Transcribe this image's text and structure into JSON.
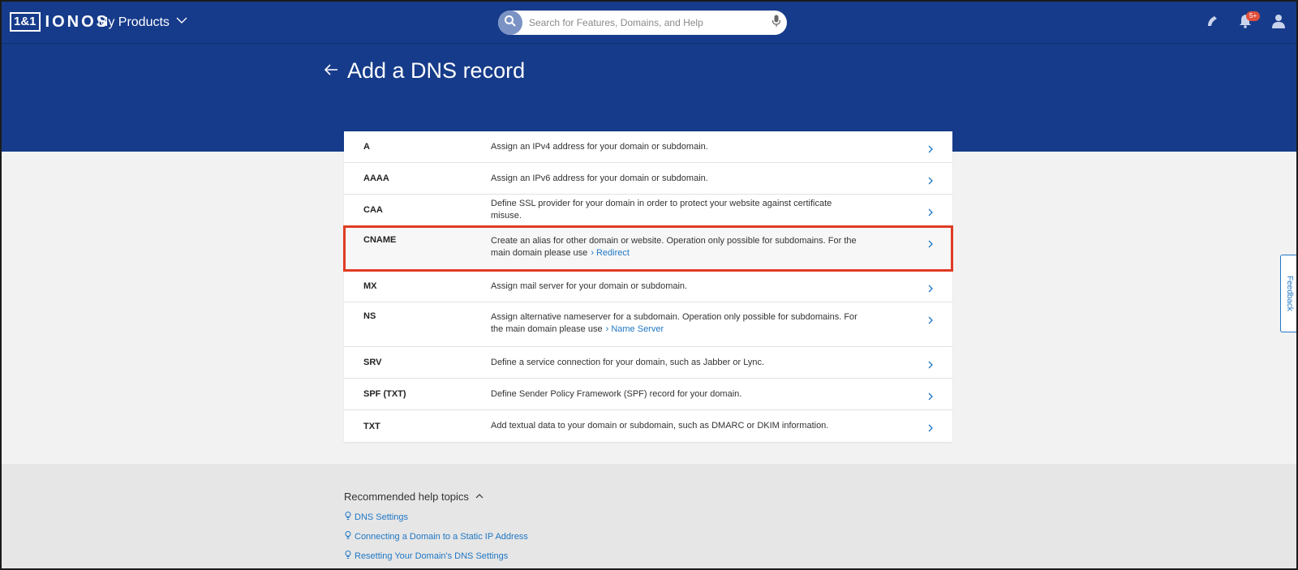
{
  "header": {
    "logo_box": "1&1",
    "logo_text": "IONOS",
    "products_label": "My Products",
    "search_placeholder": "Search for Features, Domains, and Help",
    "notification_badge": "5+"
  },
  "page": {
    "title": "Add a DNS record"
  },
  "records": [
    {
      "type": "A",
      "desc": "Assign an IPv4 address for your domain or subdomain."
    },
    {
      "type": "AAAA",
      "desc": "Assign an IPv6 address for your domain or subdomain."
    },
    {
      "type": "CAA",
      "desc": "Define SSL provider for your domain in order to protect your website against certificate misuse."
    },
    {
      "type": "CNAME",
      "desc": "Create an alias for other domain or website. Operation only possible for subdomains. For the main domain please use",
      "link": "Redirect"
    },
    {
      "type": "MX",
      "desc": "Assign mail server for your domain or subdomain."
    },
    {
      "type": "NS",
      "desc": "Assign alternative nameserver for a subdomain. Operation only possible for subdomains. For the main domain please use",
      "link": "Name Server"
    },
    {
      "type": "SRV",
      "desc": "Define a service connection for your domain, such as Jabber or Lync."
    },
    {
      "type": "SPF (TXT)",
      "desc": "Define Sender Policy Framework (SPF) record for your domain."
    },
    {
      "type": "TXT",
      "desc": "Add textual data to your domain or subdomain, such as DMARC or DKIM information."
    }
  ],
  "help": {
    "title": "Recommended help topics",
    "links": [
      "DNS Settings",
      "Connecting a Domain to a Static IP Address",
      "Resetting Your Domain's DNS Settings"
    ]
  },
  "feedback_label": "Feedback",
  "colors": {
    "header_blue": "#163b8a",
    "link_blue": "#1f77c4",
    "highlight_red": "#e03b24",
    "badge_red": "#e0503c"
  }
}
